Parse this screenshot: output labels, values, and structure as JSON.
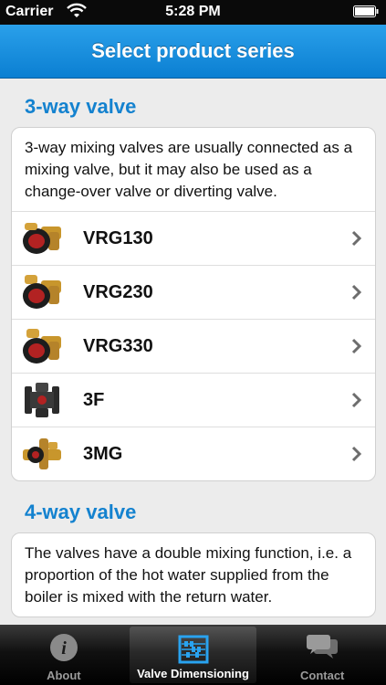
{
  "status_bar": {
    "carrier": "Carrier",
    "time": "5:28 PM"
  },
  "nav": {
    "title": "Select product series"
  },
  "sections": [
    {
      "title": "3-way valve",
      "description": "3-way mixing valves are usually connected as a mixing valve, but it may also be used as a change-over valve or diverting valve.",
      "items": [
        {
          "label": "VRG130",
          "icon": "brass-valve-icon"
        },
        {
          "label": "VRG230",
          "icon": "brass-valve-icon"
        },
        {
          "label": "VRG330",
          "icon": "brass-valve-icon"
        },
        {
          "label": "3F",
          "icon": "flanged-valve-icon"
        },
        {
          "label": "3MG",
          "icon": "brass-valve-icon"
        }
      ]
    },
    {
      "title": "4-way valve",
      "description": "The valves have a double mixing function, i.e. a proportion of the hot water supplied from the boiler is mixed with the return water."
    }
  ],
  "tabs": [
    {
      "label": "About",
      "icon": "info-icon"
    },
    {
      "label": "Valve Dimensioning",
      "icon": "abacus-icon",
      "active": true
    },
    {
      "label": "Contact",
      "icon": "chat-bubbles-icon"
    }
  ],
  "colors": {
    "accent": "#1482cf",
    "nav_top": "#2aa0ea",
    "nav_bottom": "#0b7fd2"
  }
}
